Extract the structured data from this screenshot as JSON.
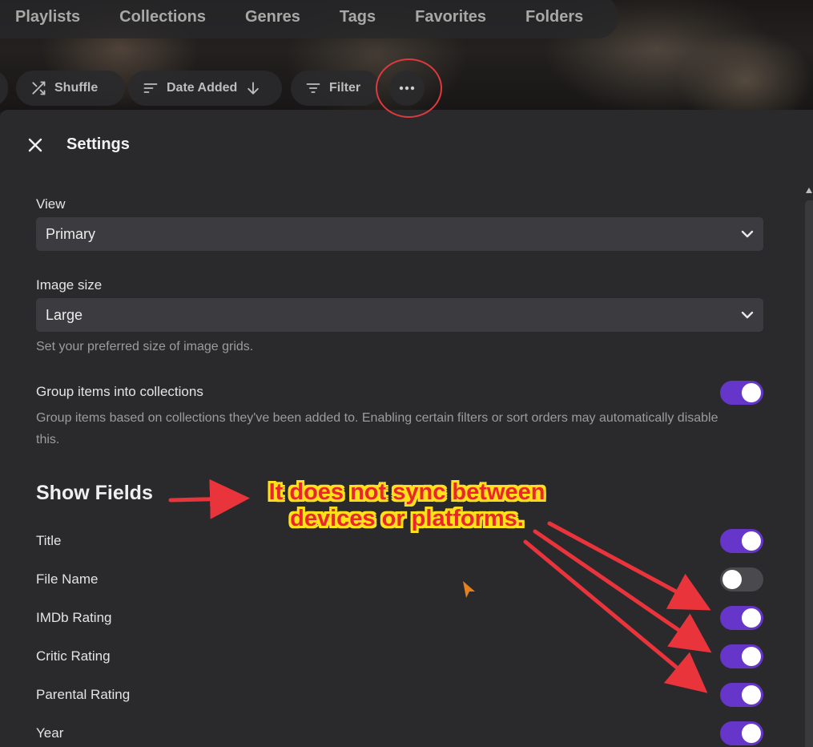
{
  "tabs": [
    "Playlists",
    "Collections",
    "Genres",
    "Tags",
    "Favorites",
    "Folders"
  ],
  "toolbar": {
    "shuffle_label": "Shuffle",
    "sort_label": "Date Added",
    "filter_label": "Filter",
    "more_icon": "ellipsis-icon"
  },
  "settings": {
    "title": "Settings",
    "view": {
      "label": "View",
      "value": "Primary"
    },
    "image_size": {
      "label": "Image size",
      "value": "Large",
      "description": "Set your preferred size of image grids."
    },
    "group_collections": {
      "label": "Group items into collections",
      "description": "Group items based on collections they've been added to. Enabling certain filters or sort orders may automatically disable this.",
      "enabled": true
    },
    "show_fields": {
      "title": "Show Fields",
      "fields": [
        {
          "label": "Title",
          "enabled": true
        },
        {
          "label": "File Name",
          "enabled": false
        },
        {
          "label": "IMDb Rating",
          "enabled": true
        },
        {
          "label": "Critic Rating",
          "enabled": true
        },
        {
          "label": "Parental Rating",
          "enabled": true
        },
        {
          "label": "Year",
          "enabled": true
        }
      ]
    }
  },
  "annotation": {
    "line1": "It does not sync between",
    "line2": "devices or platforms."
  },
  "colors": {
    "accent": "#6536c9",
    "annotation_text": "#e8262b",
    "annotation_outline": "#ffe11a",
    "highlight_circle": "#e0393e"
  }
}
